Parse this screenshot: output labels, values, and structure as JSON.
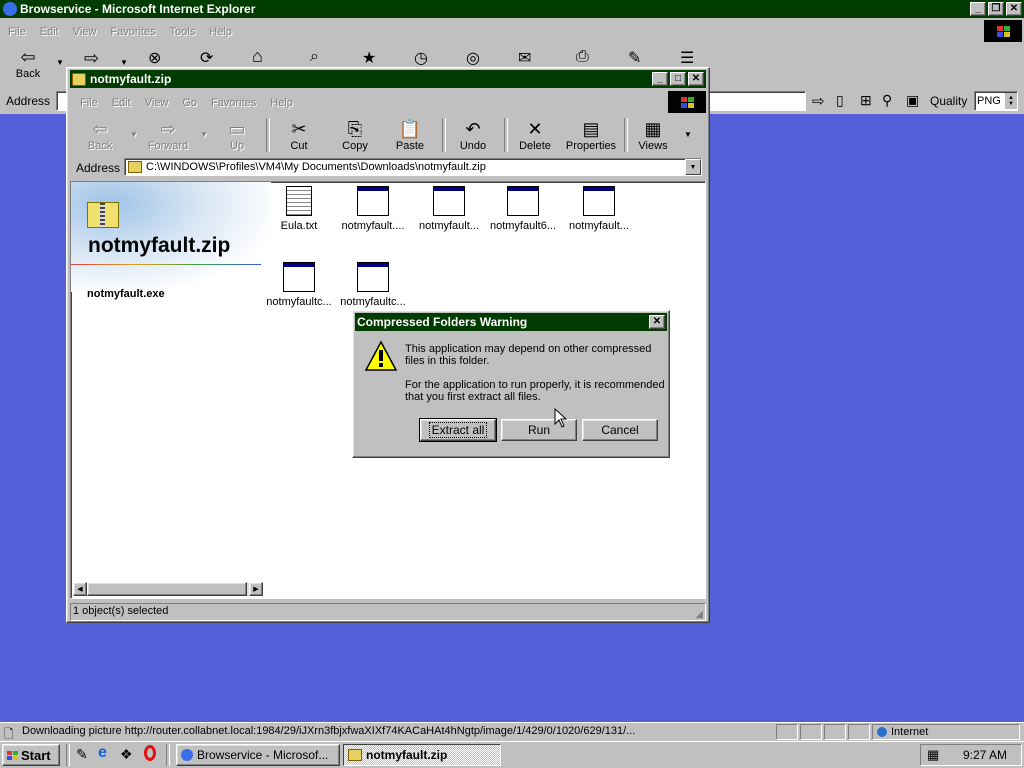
{
  "ie": {
    "title": "Browservice - Microsoft Internet Explorer",
    "menu": [
      "File",
      "Edit",
      "View",
      "Favorites",
      "Tools",
      "Help"
    ],
    "toolbar": {
      "back_label": "Back"
    },
    "address_label": "Address",
    "quality_label": "Quality",
    "quality_value": "PNG",
    "status_text": "Downloading picture http://router.collabnet.local:1984/29/iJXrn3fbjxfwaXIXf74KACaHAt4hNgtp/image/1/429/0/1020/629/131/...",
    "zone": "Internet",
    "colors": {
      "titlebar": "#003b00",
      "desktop": "#5560d8"
    }
  },
  "explorer": {
    "title": "notmyfault.zip",
    "menu": [
      "File",
      "Edit",
      "View",
      "Go",
      "Favorites",
      "Help"
    ],
    "toolbar": {
      "back": "Back",
      "forward": "Forward",
      "up": "Up",
      "cut": "Cut",
      "copy": "Copy",
      "paste": "Paste",
      "undo": "Undo",
      "delete": "Delete",
      "properties": "Properties",
      "views": "Views"
    },
    "address_label": "Address",
    "address_value": "C:\\WINDOWS\\Profiles\\VM4\\My Documents\\Downloads\\notmyfault.zip",
    "left_title": "notmyfault.zip",
    "left_selected": "notmyfault.exe",
    "files": [
      "Eula.txt",
      "notmyfault....",
      "notmyfault...",
      "notmyfault6...",
      "notmyfault...",
      "notmyfaultc...",
      "notmyfaultc..."
    ],
    "status_text": "1 object(s) selected"
  },
  "dialog": {
    "title": "Compressed Folders Warning",
    "line1": "This application may depend on other compressed",
    "line2": "files in this folder.",
    "line3": "For the application to run properly, it is recommended",
    "line4": "that you first extract all files.",
    "extract_label": "Extract all",
    "run_label": "Run",
    "cancel_label": "Cancel"
  },
  "taskbar": {
    "start_label": "Start",
    "task1": "Browservice - Microsof...",
    "task2": "notmyfault.zip",
    "clock": "9:27 AM"
  }
}
